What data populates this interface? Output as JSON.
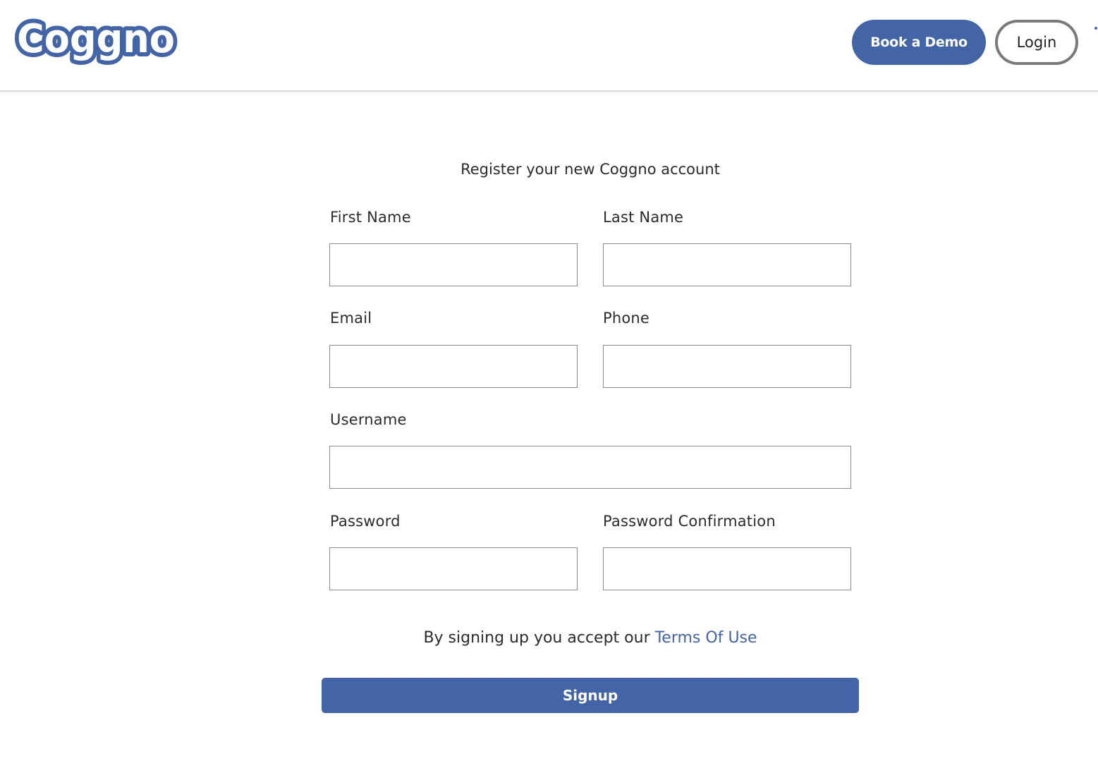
{
  "header": {
    "logo_text": "Coggno",
    "book_demo_label": "Book a Demo",
    "login_label": "Login"
  },
  "form": {
    "title": "Register your new Coggno account",
    "first_name": {
      "label": "First Name",
      "value": ""
    },
    "last_name": {
      "label": "Last Name",
      "value": ""
    },
    "email": {
      "label": "Email",
      "value": ""
    },
    "phone": {
      "label": "Phone",
      "value": ""
    },
    "username": {
      "label": "Username",
      "value": ""
    },
    "password": {
      "label": "Password",
      "value": ""
    },
    "password_confirmation": {
      "label": "Password Confirmation",
      "value": ""
    },
    "terms_prefix": "By signing up you accept our ",
    "terms_link": "Terms Of Use",
    "signup_label": "Signup"
  },
  "colors": {
    "brand": "#4464a8",
    "text": "#2b2b2b",
    "border": "#8c8c8c"
  }
}
